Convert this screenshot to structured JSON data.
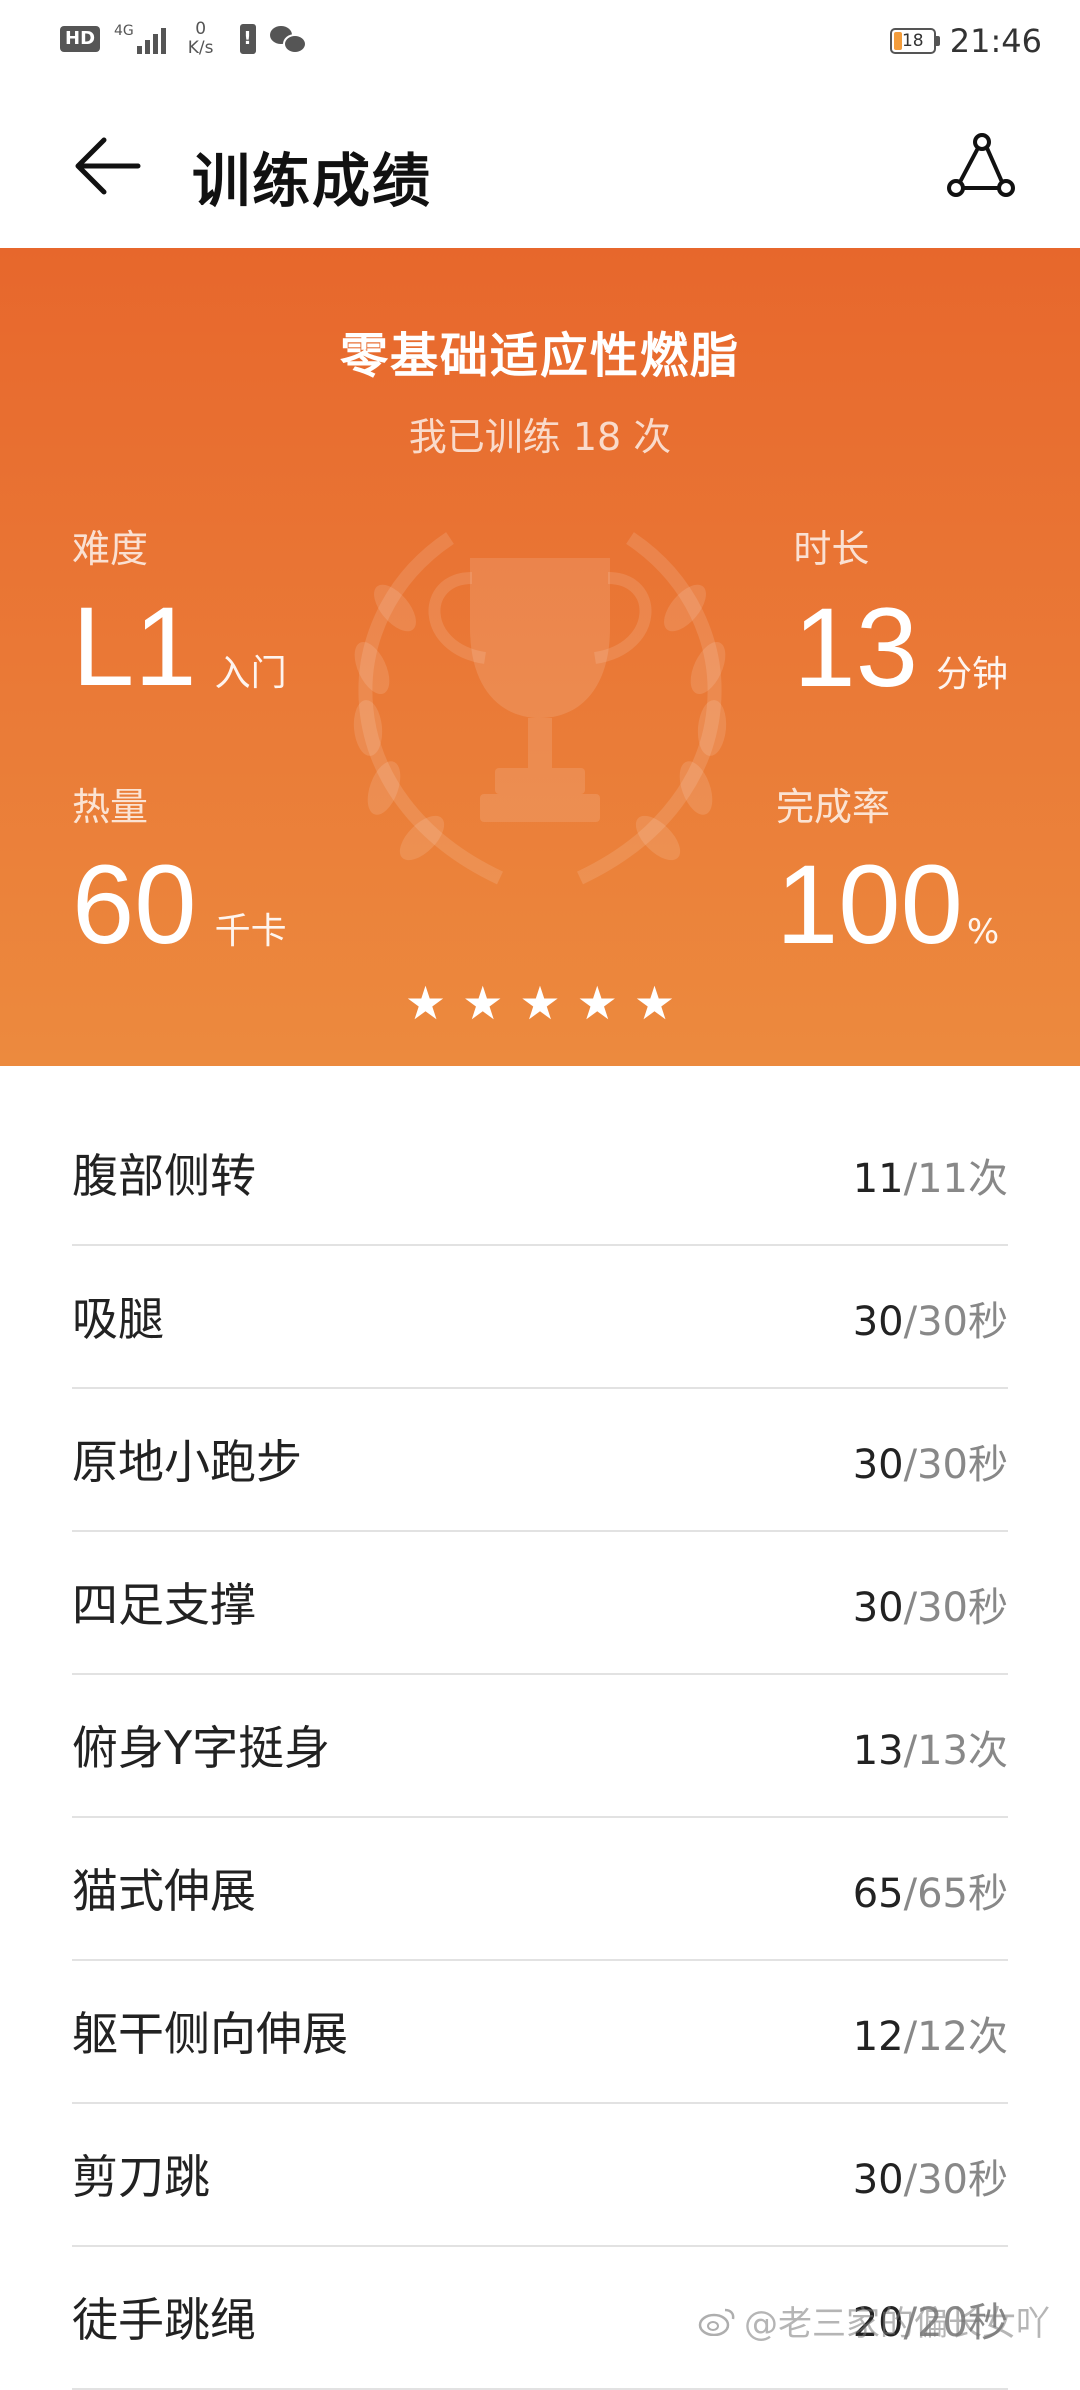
{
  "status_bar": {
    "hd": "HD",
    "network_type": "4G",
    "network_sub": "1",
    "speed_value": "0",
    "speed_unit": "K/s",
    "battery_level": "18",
    "time": "21:46"
  },
  "header": {
    "title": "训练成绩"
  },
  "summary": {
    "program_name": "零基础适应性燃脂",
    "train_count_text": "我已训练 18 次",
    "difficulty": {
      "label": "难度",
      "value": "L1",
      "unit": "入门"
    },
    "duration": {
      "label": "时长",
      "value": "13",
      "unit": "分钟"
    },
    "calories": {
      "label": "热量",
      "value": "60",
      "unit": "千卡"
    },
    "completion": {
      "label": "完成率",
      "value": "100",
      "unit": "%"
    },
    "rating": 5,
    "accent_color": "#e8702f"
  },
  "exercises": [
    {
      "name": "腹部侧转",
      "done": "11",
      "target": "11次"
    },
    {
      "name": "吸腿",
      "done": "30",
      "target": "30秒"
    },
    {
      "name": "原地小跑步",
      "done": "30",
      "target": "30秒"
    },
    {
      "name": "四足支撑",
      "done": "30",
      "target": "30秒"
    },
    {
      "name": "俯身Y字挺身",
      "done": "13",
      "target": "13次"
    },
    {
      "name": "猫式伸展",
      "done": "65",
      "target": "65秒"
    },
    {
      "name": "躯干侧向伸展",
      "done": "12",
      "target": "12次"
    },
    {
      "name": "剪刀跳",
      "done": "30",
      "target": "30秒"
    },
    {
      "name": "徒手跳绳",
      "done": "20",
      "target": "20秒"
    }
  ],
  "watermark": "@老三家的偏长女吖",
  "icons": [
    "back-arrow-icon",
    "route-share-icon",
    "trophy-icon",
    "star-icon",
    "weibo-icon"
  ]
}
